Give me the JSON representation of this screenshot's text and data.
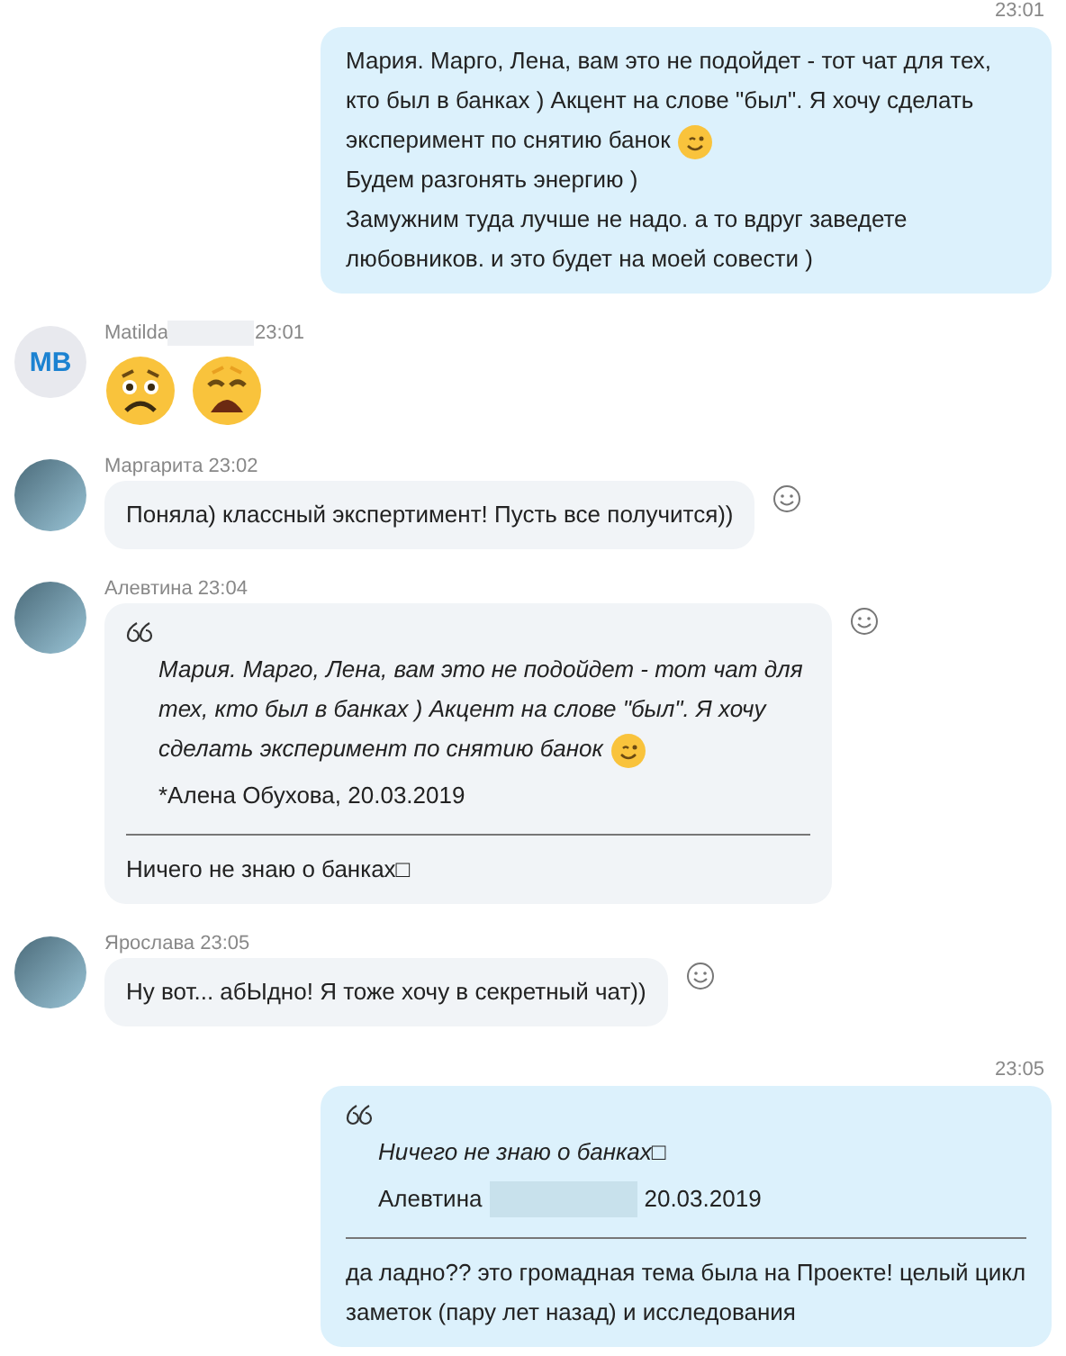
{
  "messages": [
    {
      "kind": "outgoing",
      "time": "23:01",
      "paragraphs": [
        {
          "text": "Мария. Марго, Лена, вам это не подойдет - тот чат для тех, кто был в банках ) Акцент на слове \"был\". Я хочу сделать эксперимент по снятию банок",
          "emoji": {
            "kind": "wink"
          }
        },
        {
          "text": "Будем разгонять энергию )"
        },
        {
          "text": "Замужним туда лучше не надо. а то вдруг заведете любовников. и это будет на моей совести )"
        }
      ]
    },
    {
      "kind": "incoming",
      "avatar": {
        "kind": "initials",
        "text": "MB"
      },
      "header": [
        {
          "kind": "text",
          "text": "Matilda"
        },
        {
          "kind": "redacted"
        },
        {
          "kind": "text",
          "text": "23:01"
        }
      ],
      "emojis": [
        {
          "kind": "worried"
        },
        {
          "kind": "weary"
        }
      ]
    },
    {
      "kind": "incoming",
      "avatar": {
        "kind": "photo"
      },
      "header": [
        {
          "kind": "text",
          "text": "Маргарита 23:02"
        }
      ],
      "reaction_button": true,
      "paragraphs": [
        {
          "text": "Поняла) классный экспертимент! Пусть все получится))"
        }
      ]
    },
    {
      "kind": "incoming",
      "avatar": {
        "kind": "photo"
      },
      "header": [
        {
          "kind": "text",
          "text": "Алевтина 23:04"
        }
      ],
      "reaction_button": true,
      "quote": {
        "text": "Мария. Марго, Лена, вам это не подойдет - тот чат для тех, кто был в банках ) Акцент на слове \"был\". Я хочу сделать эксперимент по снятию банок",
        "emoji": {
          "kind": "wink"
        },
        "attribution": [
          {
            "kind": "text",
            "text": "*Алена Обухова, 20.03.2019"
          }
        ]
      },
      "paragraphs": [
        {
          "text": "Ничего не знаю о банках□"
        }
      ]
    },
    {
      "kind": "incoming",
      "avatar": {
        "kind": "photo"
      },
      "header": [
        {
          "kind": "text",
          "text": "Ярослава 23:05"
        }
      ],
      "reaction_button": true,
      "paragraphs": [
        {
          "text": "Ну вот... абЫдно!  Я тоже хочу в секретный чат))"
        }
      ]
    },
    {
      "kind": "outgoing",
      "time": "23:05",
      "quote": {
        "text": "Ничего не знаю о банках□",
        "attribution": [
          {
            "kind": "text",
            "text": "Алевтина"
          },
          {
            "kind": "redacted"
          },
          {
            "kind": "text",
            "text": "20.03.2019"
          }
        ]
      },
      "paragraphs": [
        {
          "text": "да ладно?? это громадная тема была на Проекте! целый цикл заметок (пару лет назад) и исследования"
        }
      ]
    }
  ]
}
